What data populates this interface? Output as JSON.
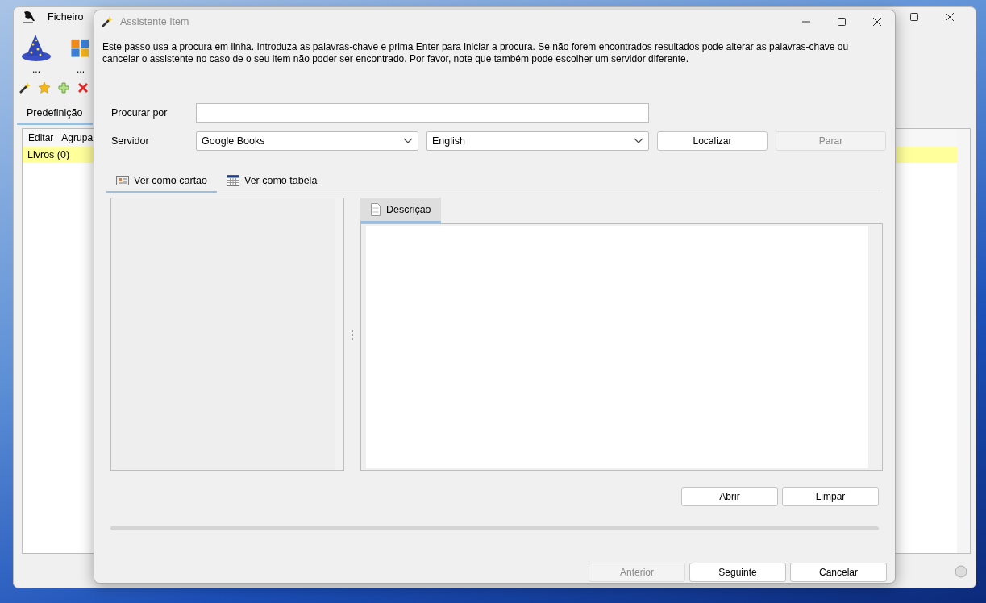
{
  "main_window": {
    "menu": [
      "Ficheiro"
    ],
    "toolbar_buttons": [
      {
        "label": "...",
        "kind": "wizard"
      },
      {
        "label": "...",
        "kind": "windows"
      }
    ],
    "tabs": [
      {
        "label": "Predefinição",
        "selected": true
      }
    ],
    "panel_menu": [
      "Editar",
      "Agrupa"
    ],
    "list_items": [
      {
        "label": "Livros (0)",
        "selected": true
      }
    ]
  },
  "dialog": {
    "title": "Assistente Item",
    "description": "Este passo usa a procura em linha. Introduza as palavras-chave e prima Enter para iniciar a procura. Se não forem encontrados resultados pode alterar as palavras-chave ou cancelar o assistente no caso de o seu item não poder ser encontrado. Por favor, note que também pode escolher um servidor diferente.",
    "search": {
      "label": "Procurar por"
    },
    "server": {
      "label": "Servidor",
      "value": "Google Books"
    },
    "language": {
      "value": "English"
    },
    "search_buttons": [
      {
        "label": "Localizar",
        "disabled": false
      },
      {
        "label": "Parar",
        "disabled": true
      }
    ],
    "view_tabs": [
      {
        "label": "Ver como cartão",
        "selected": true,
        "kind": "card"
      },
      {
        "label": "Ver como tabela",
        "selected": false,
        "kind": "table"
      }
    ],
    "detail_tabs": [
      {
        "label": "Descrição",
        "selected": true
      }
    ],
    "result_buttons": [
      {
        "label": "Abrir",
        "disabled": false
      },
      {
        "label": "Limpar",
        "disabled": false
      }
    ],
    "progress": {
      "level": 0
    },
    "nav_buttons": [
      {
        "label": "Anterior",
        "disabled": true
      },
      {
        "label": "Seguinte",
        "disabled": false
      },
      {
        "label": "Cancelar",
        "disabled": false
      }
    ]
  }
}
